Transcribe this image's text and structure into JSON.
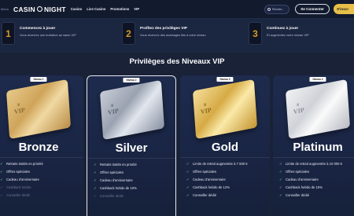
{
  "header": {
    "menu_stub": "Menu",
    "logo_left": "CASIN",
    "logo_right": "NIGHT",
    "nav": [
      "Casino",
      "Live Casino",
      "Promotions",
      "VIP"
    ],
    "search_label": "Recher...",
    "login_label": "Se Connecter",
    "signup_label": "S'inscr"
  },
  "steps": [
    {
      "num": "1",
      "title": "Commencez à jouer",
      "desc": "Vous recevrez une invitation au salon VIP"
    },
    {
      "num": "2",
      "title": "Profitez des privilèges VIP",
      "desc": "Vous recevrez des avantages liés à votre niveau"
    },
    {
      "num": "3",
      "title": "Continuez à jouer",
      "desc": "Et augmentez votre niveau VIP"
    }
  ],
  "section_title": "Privilèges des Niveaux VIP",
  "cards": [
    {
      "badge": "Niveau 1",
      "name": "Bronze",
      "vip": "VIP",
      "benefits": [
        {
          "label": "Retraits traités en priorité",
          "active": true
        },
        {
          "label": "Offres spéciales",
          "active": true
        },
        {
          "label": "Cadeau d'anniversaire",
          "active": true
        },
        {
          "label": "Cashback hebdo",
          "active": false
        },
        {
          "label": "Conseiller dédié",
          "active": false
        }
      ]
    },
    {
      "badge": "Niveau 2",
      "name": "Silver",
      "vip": "VIP",
      "benefits": [
        {
          "label": "Retraits traités en priorité",
          "active": true
        },
        {
          "label": "Offres spéciales",
          "active": true
        },
        {
          "label": "Cadeau d'anniversaire",
          "active": true
        },
        {
          "label": "Cashback hebdo de 10%",
          "active": true
        },
        {
          "label": "Conseiller dédié",
          "active": false
        }
      ]
    },
    {
      "badge": "Niveau 3",
      "name": "Gold",
      "vip": "VIP",
      "benefits": [
        {
          "label": "Limite de retrait augmentée à 7 500 €",
          "active": true
        },
        {
          "label": "Offres spéciales",
          "active": true
        },
        {
          "label": "Cadeau d'anniversaire",
          "active": true
        },
        {
          "label": "Cashback hebdo de 12%",
          "active": true
        },
        {
          "label": "Conseiller dédié",
          "active": true
        }
      ]
    },
    {
      "badge": "Niveau 4",
      "name": "Platinum",
      "vip": "VIP",
      "benefits": [
        {
          "label": "Limite de retrait augmentée à 10 000 €",
          "active": true
        },
        {
          "label": "Offres spéciales",
          "active": true
        },
        {
          "label": "Cadeau d'anniversaire",
          "active": true
        },
        {
          "label": "Cashback hebdo de 15%",
          "active": true
        },
        {
          "label": "Conseiller dédié",
          "active": true
        }
      ]
    }
  ],
  "colors": {
    "accent": "#e7c04a",
    "background": "#1a2238",
    "step_number": "#d49a2a"
  },
  "icons": {
    "check": "check-icon",
    "search": "search-icon",
    "crown": "crown-icon"
  }
}
